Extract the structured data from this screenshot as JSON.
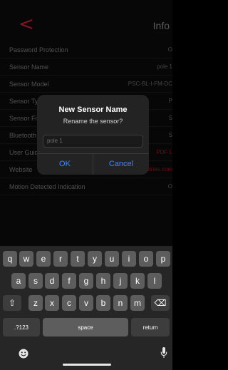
{
  "nav": {
    "back_glyph": "<",
    "title": "Info"
  },
  "rows": [
    {
      "label": "Password Protection",
      "value": "O"
    },
    {
      "label": "Sensor Name",
      "value": "pole 1"
    },
    {
      "label": "Sensor Model",
      "value": "PSC-BL-I-FM-DC"
    },
    {
      "label": "Sensor Type",
      "value": "P"
    },
    {
      "label": "Sensor Firmware",
      "value": "S"
    },
    {
      "label": "Bluetooth",
      "value": "S"
    },
    {
      "label": "User Guide",
      "value": "PDF L"
    },
    {
      "label": "Website",
      "value": "LSI-industries.com"
    },
    {
      "label": "Motion Detected Indication",
      "value": "O"
    }
  ],
  "dialog": {
    "title": "New Sensor Name",
    "message": "Rename the sensor?",
    "input_placeholder": "pole 1",
    "ok_label": "OK",
    "cancel_label": "Cancel"
  },
  "keyboard": {
    "row1": [
      "q",
      "w",
      "e",
      "r",
      "t",
      "y",
      "u",
      "i",
      "o",
      "p"
    ],
    "row2": [
      "a",
      "s",
      "d",
      "f",
      "g",
      "h",
      "j",
      "k",
      "l"
    ],
    "row3": [
      "z",
      "x",
      "c",
      "v",
      "b",
      "n",
      "m"
    ],
    "shift_glyph": "⇧",
    "backspace_glyph": "⌫",
    "numbers_label": ".?123",
    "space_label": "space",
    "return_label": "return"
  },
  "colors": {
    "accent": "#c81e3c",
    "link": "#3b88ff",
    "danger": "#a3101e"
  }
}
